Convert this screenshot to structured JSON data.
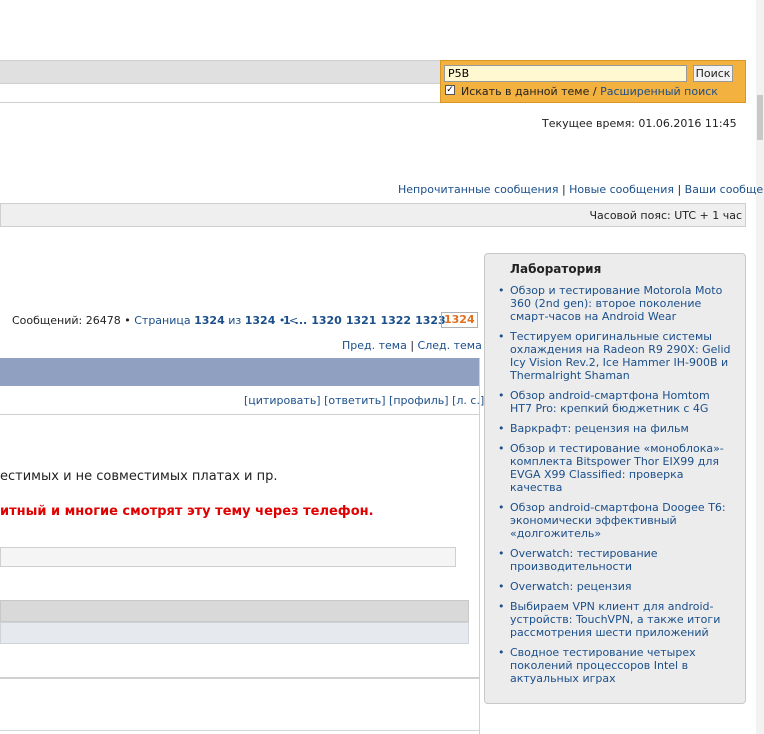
{
  "search": {
    "value": "P5B",
    "button": "Поиск",
    "checkbox_label": "Искать в данной теме",
    "separator": " / ",
    "advanced_link": "Расширенный поиск",
    "checked": true
  },
  "header": {
    "current_time": "Текущее время: 01.06.2016 11:45"
  },
  "quick_links": {
    "unread": "Непрочитанные сообщения",
    "new": "Новые сообщения",
    "yours": "Ваши сообщения",
    "sep": " | "
  },
  "timezone": "Часовой пояс: UTC + 1 час",
  "pagination": {
    "messages_label": "Сообщений: 26478 •",
    "page_word": "Страница",
    "page_current": "1324",
    "of_word": "из",
    "page_total": "1324",
    "prev_marker": "• <",
    "pages": [
      "1",
      "...",
      "1320",
      "1321",
      "1322",
      "1323"
    ],
    "active_page": "1324"
  },
  "topic_nav": {
    "prev": "Пред. тема",
    "sep": " | ",
    "next": "След. тема"
  },
  "post": {
    "actions": [
      "[цитировать]",
      "[ответить]",
      "[профиль]",
      "[л. с.]"
    ],
    "text_line1": "естимых и не совместимых платах и пр.",
    "text_line2": "итный и многие смотрят эту тему через телефон."
  },
  "sidebar": {
    "title": "Лаборатория",
    "items": [
      "Обзор и тестирование Motorola Moto 360 (2nd gen): второе поколение смарт-часов на Android Wear",
      "Тестируем оригинальные системы охлаждения на Radeon R9 290X: Gelid Icy Vision Rev.2, Ice Hammer IH-900B и Thermalright Shaman",
      "Обзор android-смартфона Homtom HT7 Pro: крепкий бюджетник с 4G",
      "Варкрафт: рецензия на фильм",
      "Обзор и тестирование «моноблока»-комплекта Bitspower Thor EIX99 для EVGA X99 Classified: проверка качества",
      "Обзор android-смартфона Doogee T6: экономически эффективный «долгожитель»",
      "Overwatch: тестирование производительности",
      "Overwatch: рецензия",
      "Выбираем VPN клиент для android-устройств: TouchVPN, а также итоги рассмотрения шести приложений",
      "Сводное тестирование четырех поколений процессоров Intel в актуальных играх"
    ]
  },
  "colors": {
    "link": "#1b4f8a",
    "search_bg": "#f3b13f",
    "post_header": "#8fa0c0",
    "warning_text": "#e00000",
    "active_page": "#e07020"
  }
}
